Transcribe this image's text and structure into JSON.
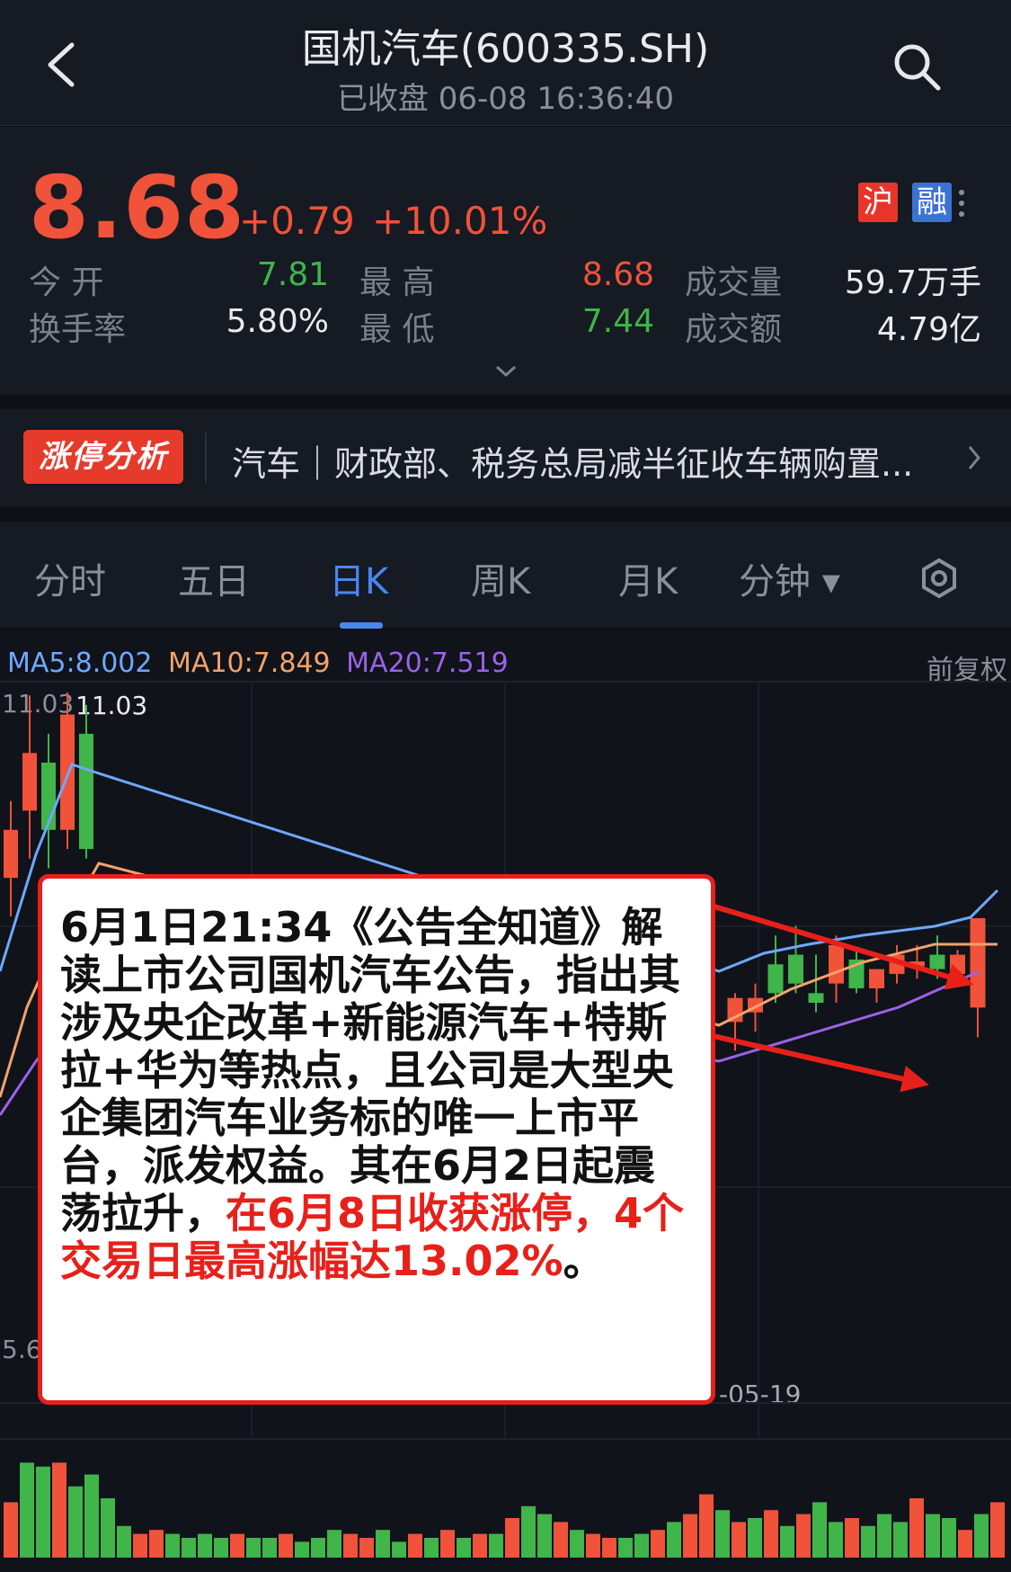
{
  "header": {
    "title": "国机汽车(600335.SH)",
    "status": "已收盘 06-08 16:36:40"
  },
  "quote": {
    "price": "8.68",
    "change": "+0.79",
    "change_pct": "+10.01%",
    "badge_hu": "沪",
    "badge_rong": "融",
    "open_label": "今 开",
    "open_value": "7.81",
    "high_label": "最 高",
    "high_value": "8.68",
    "volume_label": "成交量",
    "volume_value": "59.7万手",
    "turnover_label": "换手率",
    "turnover_value": "5.80%",
    "low_label": "最 低",
    "low_value": "7.44",
    "amount_label": "成交额",
    "amount_value": "4.79亿"
  },
  "news": {
    "tag": "涨停分析",
    "text": "汽车｜财政部、税务总局减半征收车辆购置..."
  },
  "tabs": [
    {
      "label": "分时"
    },
    {
      "label": "五日"
    },
    {
      "label": "日K"
    },
    {
      "label": "周K"
    },
    {
      "label": "月K"
    },
    {
      "label": "分钟 ▾"
    }
  ],
  "chart": {
    "ma5": "MA5:8.002",
    "ma10": "MA10:7.849",
    "ma20": "MA20:7.519",
    "adjust": "前复权",
    "y_top_left": "11.03",
    "y_top_marker": "11.03",
    "y_bottom_left": "5.6",
    "date_label": "-05-19"
  },
  "annotation": {
    "text_black": "6月1日21:34《公告全知道》解读上市公司国机汽车公告，指出其涉及央企改革+新能源汽车+特斯拉+华为等热点，且公司是大型央企集团汽车业务标的唯一上市平台，派发权益。其在6月2日起震荡拉升，",
    "text_red": "在6月8日收获涨停，4个交易日最高涨幅达13.02%",
    "text_end": "。"
  },
  "colors": {
    "up": "#f0523a",
    "down": "#3fb54a",
    "accent": "#4a86f0",
    "ma5": "#6fa8ff",
    "ma10": "#f2a36b",
    "ma20": "#9a63e6"
  },
  "chart_data": {
    "type": "candlestick",
    "ohlc": [
      [
        9.1,
        9.9,
        8.7,
        9.6
      ],
      [
        9.8,
        11.0,
        9.3,
        10.4
      ],
      [
        10.3,
        10.6,
        9.2,
        9.6
      ],
      [
        9.6,
        11.03,
        9.4,
        10.8
      ],
      [
        10.6,
        10.9,
        9.3,
        9.4
      ]
    ],
    "ohlc_right": [
      [
        7.6,
        7.9,
        7.3,
        7.85
      ],
      [
        7.7,
        8.0,
        7.5,
        7.85
      ],
      [
        8.2,
        8.5,
        7.8,
        7.9
      ],
      [
        8.3,
        8.6,
        7.9,
        8.0
      ],
      [
        7.9,
        8.3,
        7.7,
        7.8
      ],
      [
        8.0,
        8.5,
        7.8,
        8.4
      ],
      [
        8.25,
        8.35,
        7.9,
        7.95
      ],
      [
        7.95,
        8.15,
        7.8,
        8.15
      ],
      [
        8.1,
        8.4,
        8.0,
        8.3
      ],
      [
        8.18,
        8.4,
        8.05,
        8.23
      ],
      [
        8.3,
        8.5,
        8.05,
        8.15
      ],
      [
        8.1,
        8.35,
        8.0,
        8.3
      ],
      [
        7.75,
        8.5,
        7.44,
        8.68
      ]
    ],
    "volume": [
      [
        28,
        "up"
      ],
      [
        48,
        "down"
      ],
      [
        46,
        "down"
      ],
      [
        48,
        "up"
      ],
      [
        36,
        "down"
      ],
      [
        42,
        "down"
      ],
      [
        30,
        "down"
      ],
      [
        16,
        "down"
      ],
      [
        12,
        "up"
      ],
      [
        14,
        "up"
      ],
      [
        12,
        "down"
      ],
      [
        10,
        "down"
      ],
      [
        12,
        "down"
      ],
      [
        10,
        "down"
      ],
      [
        12,
        "up"
      ],
      [
        10,
        "down"
      ],
      [
        10,
        "down"
      ],
      [
        12,
        "up"
      ],
      [
        8,
        "down"
      ],
      [
        10,
        "down"
      ],
      [
        14,
        "down"
      ],
      [
        12,
        "up"
      ],
      [
        10,
        "up"
      ],
      [
        14,
        "down"
      ],
      [
        8,
        "down"
      ],
      [
        12,
        "up"
      ],
      [
        10,
        "down"
      ],
      [
        14,
        "up"
      ],
      [
        10,
        "down"
      ],
      [
        12,
        "up"
      ],
      [
        12,
        "down"
      ],
      [
        20,
        "up"
      ],
      [
        26,
        "down"
      ],
      [
        22,
        "down"
      ],
      [
        18,
        "up"
      ],
      [
        14,
        "down"
      ],
      [
        12,
        "up"
      ],
      [
        10,
        "up"
      ],
      [
        10,
        "down"
      ],
      [
        12,
        "down"
      ],
      [
        14,
        "up"
      ],
      [
        18,
        "down"
      ],
      [
        22,
        "up"
      ],
      [
        32,
        "up"
      ],
      [
        24,
        "down"
      ],
      [
        18,
        "up"
      ],
      [
        20,
        "down"
      ],
      [
        24,
        "up"
      ],
      [
        16,
        "down"
      ],
      [
        22,
        "up"
      ],
      [
        28,
        "down"
      ],
      [
        18,
        "down"
      ],
      [
        20,
        "up"
      ],
      [
        16,
        "down"
      ],
      [
        22,
        "down"
      ],
      [
        18,
        "down"
      ],
      [
        30,
        "up"
      ],
      [
        22,
        "down"
      ],
      [
        20,
        "down"
      ],
      [
        14,
        "up"
      ],
      [
        22,
        "down"
      ],
      [
        28,
        "up"
      ]
    ]
  }
}
